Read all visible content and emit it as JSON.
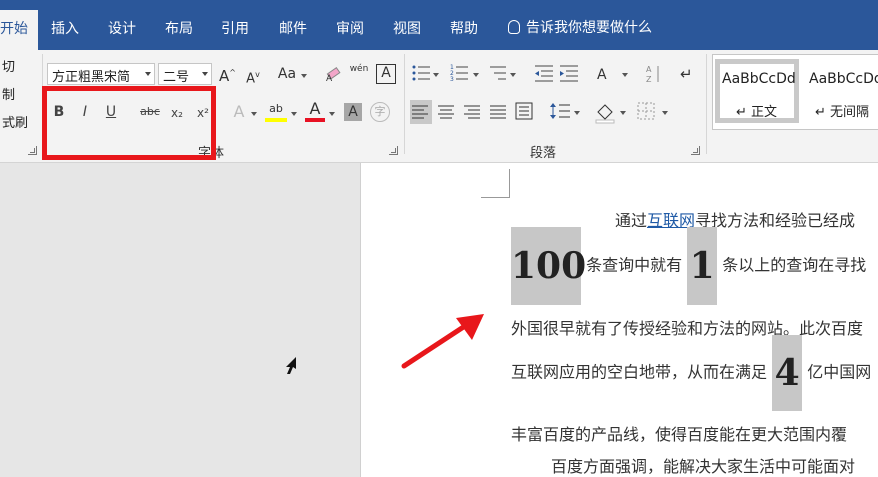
{
  "tabs": [
    {
      "label": "开始",
      "active": true
    },
    {
      "label": "插入"
    },
    {
      "label": "设计"
    },
    {
      "label": "布局"
    },
    {
      "label": "引用"
    },
    {
      "label": "邮件"
    },
    {
      "label": "审阅"
    },
    {
      "label": "视图"
    },
    {
      "label": "帮助"
    }
  ],
  "tell_me": "告诉我你想要做什么",
  "clipboard": {
    "items": [
      "切",
      "制",
      "式刷"
    ]
  },
  "font": {
    "group_label": "字体",
    "font_name": "方正粗黑宋简",
    "font_size": "二号",
    "grow": "A",
    "shrink": "A",
    "change_case": "Aa",
    "phonetic": "wén",
    "border_char": "A",
    "bold": "B",
    "italic": "I",
    "underline": "U",
    "strike": "abc",
    "subscript": "x₂",
    "superscript": "x²",
    "effects": "A",
    "highlight": "ab",
    "font_color": "A",
    "shading": "A",
    "enclose": "字"
  },
  "paragraph": {
    "group_label": "段落"
  },
  "styles": [
    {
      "sample": "AaBbCcDd",
      "name": "↵ 正文"
    },
    {
      "sample": "AaBbCcDd",
      "name": "↵ 无间隔"
    }
  ],
  "document": {
    "line1_pre": "通过",
    "line1_link": "互联网",
    "line1_post": "寻找方法和经验已经成",
    "big1": "100",
    "line2_mid": "条查询中就有",
    "big2": "1",
    "line2_post": "条以上的查询在寻找",
    "line3": "外国很早就有了传授经验和方法的网站。此次百度",
    "line4_pre": "互联网应用的空白地带，从而在满足",
    "big3": "4",
    "line4_post": "亿中国网",
    "line5": "丰富百度的产品线，使得百度能在更大范围内覆",
    "line6": "百度方面强调，能解决大家生活中可能面对"
  },
  "colors": {
    "accent": "#2b579a",
    "highlight_box": "#e8171b",
    "annotation_arrow": "#e8171b"
  }
}
